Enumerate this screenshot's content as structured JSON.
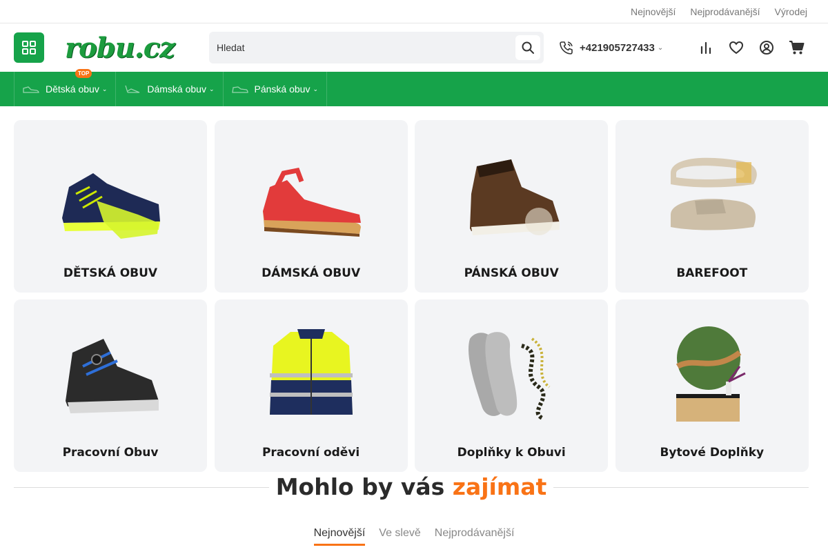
{
  "top_links": [
    "Nejnovější",
    "Nejprodávanější",
    "Výrodej"
  ],
  "logo_text": "robu.cz",
  "search": {
    "placeholder": "Hledat"
  },
  "phone": "+421905727433",
  "nav": [
    {
      "label": "Dětská obuv",
      "badge": "TOP"
    },
    {
      "label": "Dámská obuv"
    },
    {
      "label": "Pánská obuv"
    }
  ],
  "categories": [
    {
      "label": "DĚTSKÁ OBUV",
      "icon": "sneaker-image"
    },
    {
      "label": "DÁMSKÁ OBUV",
      "icon": "sandal-image"
    },
    {
      "label": "PÁNSKÁ OBUV",
      "icon": "boot-image"
    },
    {
      "label": "BAREFOOT",
      "icon": "barefoot-shoe-image"
    },
    {
      "label": "Pracovní Obuv",
      "icon": "work-shoe-image"
    },
    {
      "label": "Pracovní oděvi",
      "icon": "hi-vis-jacket-image"
    },
    {
      "label": "Doplňky k Obuvi",
      "icon": "insoles-laces-image"
    },
    {
      "label": "Bytové Doplňky",
      "icon": "home-decor-image"
    }
  ],
  "section": {
    "title_main": "Mohlo by vás",
    "title_accent": "zajímat"
  },
  "tabs": [
    "Nejnovější",
    "Ve slevě",
    "Nejprodávanější"
  ],
  "colors": {
    "brand_green": "#16a34a",
    "accent_orange": "#f97316"
  }
}
